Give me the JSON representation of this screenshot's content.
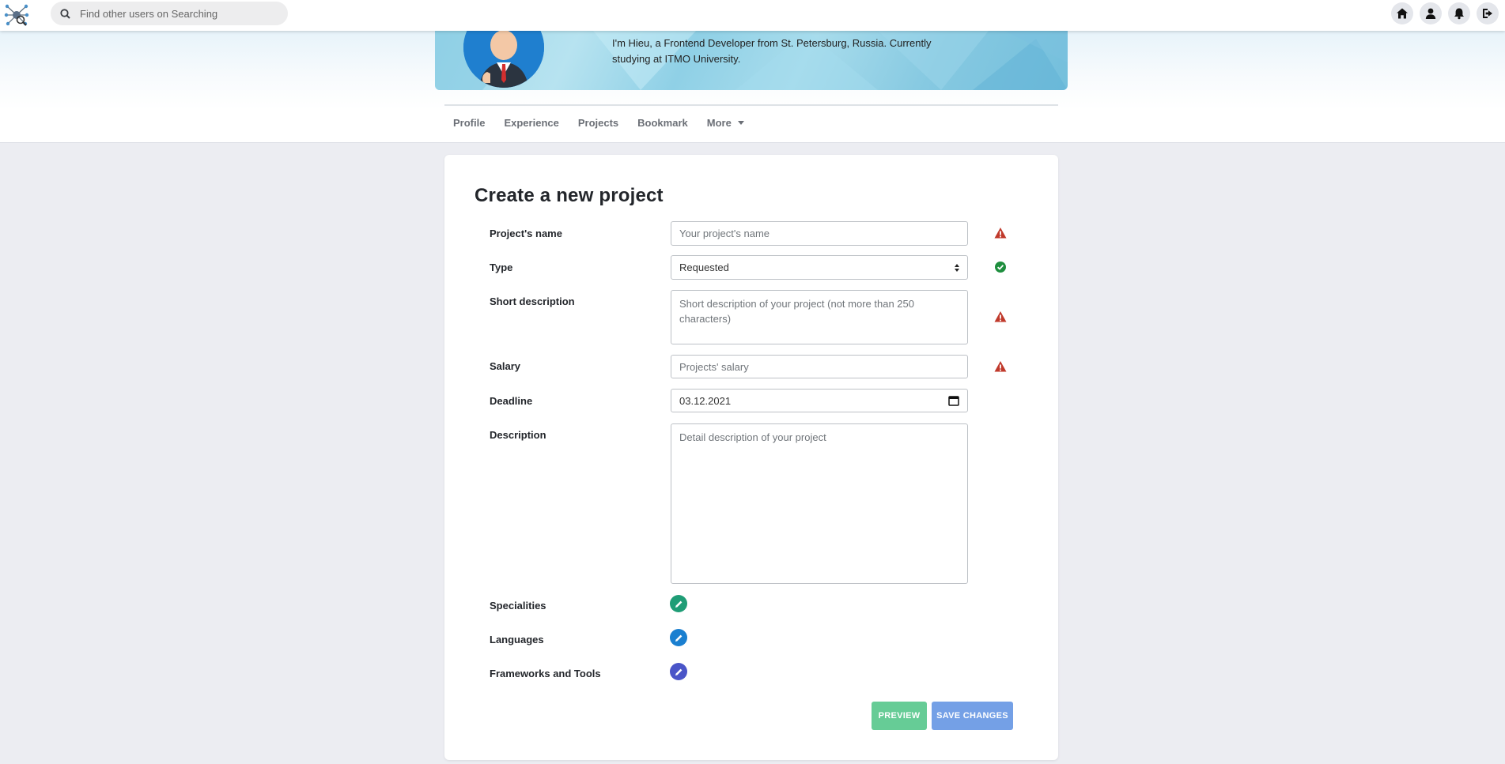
{
  "search": {
    "placeholder": "Find other users on Searching"
  },
  "nav_icons": [
    "home-icon",
    "user-icon",
    "bell-icon",
    "logout-icon"
  ],
  "profile": {
    "bio": "I'm Hieu, a Frontend Developer from St. Petersburg, Russia. Currently studying at ITMO University."
  },
  "tabs": [
    {
      "label": "Profile"
    },
    {
      "label": "Experience"
    },
    {
      "label": "Projects"
    },
    {
      "label": "Bookmark"
    },
    {
      "label": "More"
    }
  ],
  "form": {
    "title": "Create a new project",
    "name": {
      "label": "Project's name",
      "placeholder": "Your project's name",
      "status": "warning"
    },
    "type": {
      "label": "Type",
      "value": "Requested",
      "status": "valid"
    },
    "short_description": {
      "label": "Short description",
      "placeholder": "Short description of your project (not more than 250 characters)",
      "status": "warning"
    },
    "salary": {
      "label": "Salary",
      "placeholder": "Projects' salary",
      "status": "warning"
    },
    "deadline": {
      "label": "Deadline",
      "value": "03.12.2021"
    },
    "description": {
      "label": "Description",
      "placeholder": "Detail description of your project"
    },
    "specialities": {
      "label": "Specialities"
    },
    "languages": {
      "label": "Languages"
    },
    "frameworks": {
      "label": "Frameworks and Tools"
    },
    "preview_label": "PREVIEW",
    "save_label": "SAVE CHANGES"
  },
  "colors": {
    "warning": "#c0392b",
    "valid": "#1e8e3e",
    "specialities_pen": "#1f9d76",
    "languages_pen": "#1a7fd0",
    "frameworks_pen": "#4a55c8",
    "preview_button": "#66cc96",
    "save_button": "#74a0e6"
  }
}
